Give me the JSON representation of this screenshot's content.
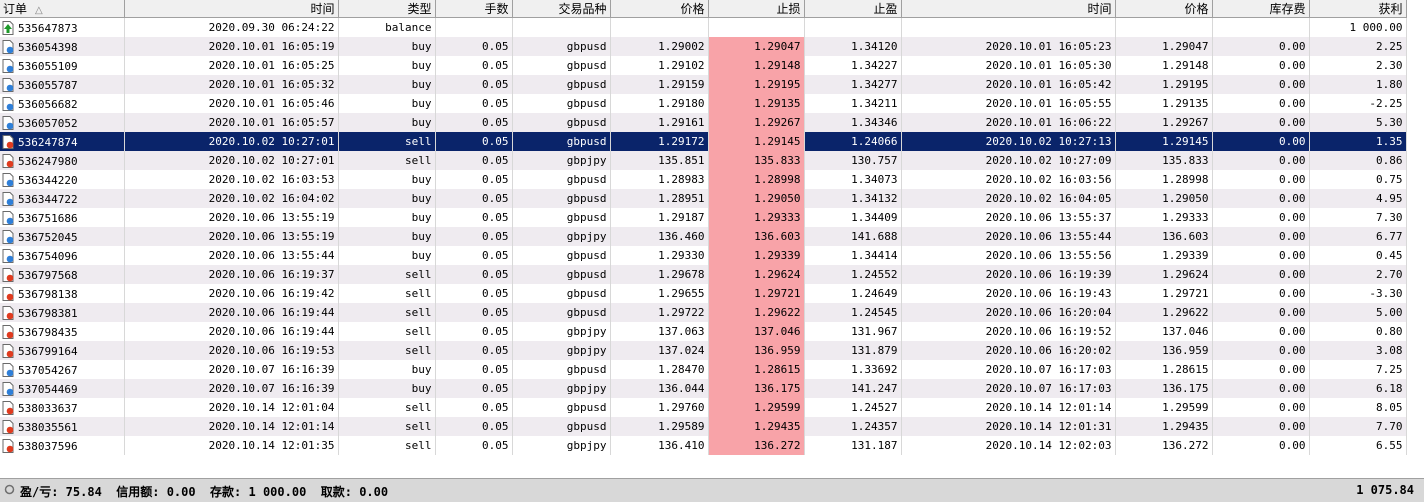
{
  "columns": [
    "订单",
    "时间",
    "类型",
    "手数",
    "交易品种",
    "价格",
    "止损",
    "止盈",
    "时间",
    "价格",
    "库存费",
    "获利"
  ],
  "sort_indicator": "△",
  "rows": [
    {
      "ticket": "535647873",
      "open_time": "2020.09.30 06:24:22",
      "type": "balance",
      "lots": "",
      "symbol": "",
      "price": "",
      "sl": "",
      "tp": "",
      "close_time": "",
      "close_price": "",
      "swap": "",
      "profit": "1 000.00",
      "icon": "deposit-icon"
    },
    {
      "ticket": "536054398",
      "open_time": "2020.10.01 16:05:19",
      "type": "buy",
      "lots": "0.05",
      "symbol": "gbpusd",
      "price": "1.29002",
      "sl": "1.29047",
      "tp": "1.34120",
      "close_time": "2020.10.01 16:05:23",
      "close_price": "1.29047",
      "swap": "0.00",
      "profit": "2.25",
      "icon": "buy-order-icon"
    },
    {
      "ticket": "536055109",
      "open_time": "2020.10.01 16:05:25",
      "type": "buy",
      "lots": "0.05",
      "symbol": "gbpusd",
      "price": "1.29102",
      "sl": "1.29148",
      "tp": "1.34227",
      "close_time": "2020.10.01 16:05:30",
      "close_price": "1.29148",
      "swap": "0.00",
      "profit": "2.30",
      "icon": "buy-order-icon"
    },
    {
      "ticket": "536055787",
      "open_time": "2020.10.01 16:05:32",
      "type": "buy",
      "lots": "0.05",
      "symbol": "gbpusd",
      "price": "1.29159",
      "sl": "1.29195",
      "tp": "1.34277",
      "close_time": "2020.10.01 16:05:42",
      "close_price": "1.29195",
      "swap": "0.00",
      "profit": "1.80",
      "icon": "buy-order-icon"
    },
    {
      "ticket": "536056682",
      "open_time": "2020.10.01 16:05:46",
      "type": "buy",
      "lots": "0.05",
      "symbol": "gbpusd",
      "price": "1.29180",
      "sl": "1.29135",
      "tp": "1.34211",
      "close_time": "2020.10.01 16:05:55",
      "close_price": "1.29135",
      "swap": "0.00",
      "profit": "-2.25",
      "icon": "buy-order-icon"
    },
    {
      "ticket": "536057052",
      "open_time": "2020.10.01 16:05:57",
      "type": "buy",
      "lots": "0.05",
      "symbol": "gbpusd",
      "price": "1.29161",
      "sl": "1.29267",
      "tp": "1.34346",
      "close_time": "2020.10.01 16:06:22",
      "close_price": "1.29267",
      "swap": "0.00",
      "profit": "5.30",
      "icon": "buy-order-icon"
    },
    {
      "ticket": "536247874",
      "open_time": "2020.10.02 10:27:01",
      "type": "sell",
      "lots": "0.05",
      "symbol": "gbpusd",
      "price": "1.29172",
      "sl": "1.29145",
      "tp": "1.24066",
      "close_time": "2020.10.02 10:27:13",
      "close_price": "1.29145",
      "swap": "0.00",
      "profit": "1.35",
      "icon": "sell-order-icon",
      "selected": true
    },
    {
      "ticket": "536247980",
      "open_time": "2020.10.02 10:27:01",
      "type": "sell",
      "lots": "0.05",
      "symbol": "gbpjpy",
      "price": "135.851",
      "sl": "135.833",
      "tp": "130.757",
      "close_time": "2020.10.02 10:27:09",
      "close_price": "135.833",
      "swap": "0.00",
      "profit": "0.86",
      "icon": "sell-order-icon"
    },
    {
      "ticket": "536344220",
      "open_time": "2020.10.02 16:03:53",
      "type": "buy",
      "lots": "0.05",
      "symbol": "gbpusd",
      "price": "1.28983",
      "sl": "1.28998",
      "tp": "1.34073",
      "close_time": "2020.10.02 16:03:56",
      "close_price": "1.28998",
      "swap": "0.00",
      "profit": "0.75",
      "icon": "buy-order-icon"
    },
    {
      "ticket": "536344722",
      "open_time": "2020.10.02 16:04:02",
      "type": "buy",
      "lots": "0.05",
      "symbol": "gbpusd",
      "price": "1.28951",
      "sl": "1.29050",
      "tp": "1.34132",
      "close_time": "2020.10.02 16:04:05",
      "close_price": "1.29050",
      "swap": "0.00",
      "profit": "4.95",
      "icon": "buy-order-icon"
    },
    {
      "ticket": "536751686",
      "open_time": "2020.10.06 13:55:19",
      "type": "buy",
      "lots": "0.05",
      "symbol": "gbpusd",
      "price": "1.29187",
      "sl": "1.29333",
      "tp": "1.34409",
      "close_time": "2020.10.06 13:55:37",
      "close_price": "1.29333",
      "swap": "0.00",
      "profit": "7.30",
      "icon": "buy-order-icon"
    },
    {
      "ticket": "536752045",
      "open_time": "2020.10.06 13:55:19",
      "type": "buy",
      "lots": "0.05",
      "symbol": "gbpjpy",
      "price": "136.460",
      "sl": "136.603",
      "tp": "141.688",
      "close_time": "2020.10.06 13:55:44",
      "close_price": "136.603",
      "swap": "0.00",
      "profit": "6.77",
      "icon": "buy-order-icon"
    },
    {
      "ticket": "536754096",
      "open_time": "2020.10.06 13:55:44",
      "type": "buy",
      "lots": "0.05",
      "symbol": "gbpusd",
      "price": "1.29330",
      "sl": "1.29339",
      "tp": "1.34414",
      "close_time": "2020.10.06 13:55:56",
      "close_price": "1.29339",
      "swap": "0.00",
      "profit": "0.45",
      "icon": "buy-order-icon"
    },
    {
      "ticket": "536797568",
      "open_time": "2020.10.06 16:19:37",
      "type": "sell",
      "lots": "0.05",
      "symbol": "gbpusd",
      "price": "1.29678",
      "sl": "1.29624",
      "tp": "1.24552",
      "close_time": "2020.10.06 16:19:39",
      "close_price": "1.29624",
      "swap": "0.00",
      "profit": "2.70",
      "icon": "sell-order-icon"
    },
    {
      "ticket": "536798138",
      "open_time": "2020.10.06 16:19:42",
      "type": "sell",
      "lots": "0.05",
      "symbol": "gbpusd",
      "price": "1.29655",
      "sl": "1.29721",
      "tp": "1.24649",
      "close_time": "2020.10.06 16:19:43",
      "close_price": "1.29721",
      "swap": "0.00",
      "profit": "-3.30",
      "icon": "sell-order-icon"
    },
    {
      "ticket": "536798381",
      "open_time": "2020.10.06 16:19:44",
      "type": "sell",
      "lots": "0.05",
      "symbol": "gbpusd",
      "price": "1.29722",
      "sl": "1.29622",
      "tp": "1.24545",
      "close_time": "2020.10.06 16:20:04",
      "close_price": "1.29622",
      "swap": "0.00",
      "profit": "5.00",
      "icon": "sell-order-icon"
    },
    {
      "ticket": "536798435",
      "open_time": "2020.10.06 16:19:44",
      "type": "sell",
      "lots": "0.05",
      "symbol": "gbpjpy",
      "price": "137.063",
      "sl": "137.046",
      "tp": "131.967",
      "close_time": "2020.10.06 16:19:52",
      "close_price": "137.046",
      "swap": "0.00",
      "profit": "0.80",
      "icon": "sell-order-icon"
    },
    {
      "ticket": "536799164",
      "open_time": "2020.10.06 16:19:53",
      "type": "sell",
      "lots": "0.05",
      "symbol": "gbpjpy",
      "price": "137.024",
      "sl": "136.959",
      "tp": "131.879",
      "close_time": "2020.10.06 16:20:02",
      "close_price": "136.959",
      "swap": "0.00",
      "profit": "3.08",
      "icon": "sell-order-icon"
    },
    {
      "ticket": "537054267",
      "open_time": "2020.10.07 16:16:39",
      "type": "buy",
      "lots": "0.05",
      "symbol": "gbpusd",
      "price": "1.28470",
      "sl": "1.28615",
      "tp": "1.33692",
      "close_time": "2020.10.07 16:17:03",
      "close_price": "1.28615",
      "swap": "0.00",
      "profit": "7.25",
      "icon": "buy-order-icon"
    },
    {
      "ticket": "537054469",
      "open_time": "2020.10.07 16:16:39",
      "type": "buy",
      "lots": "0.05",
      "symbol": "gbpjpy",
      "price": "136.044",
      "sl": "136.175",
      "tp": "141.247",
      "close_time": "2020.10.07 16:17:03",
      "close_price": "136.175",
      "swap": "0.00",
      "profit": "6.18",
      "icon": "buy-order-icon"
    },
    {
      "ticket": "538033637",
      "open_time": "2020.10.14 12:01:04",
      "type": "sell",
      "lots": "0.05",
      "symbol": "gbpusd",
      "price": "1.29760",
      "sl": "1.29599",
      "tp": "1.24527",
      "close_time": "2020.10.14 12:01:14",
      "close_price": "1.29599",
      "swap": "0.00",
      "profit": "8.05",
      "icon": "sell-order-icon"
    },
    {
      "ticket": "538035561",
      "open_time": "2020.10.14 12:01:14",
      "type": "sell",
      "lots": "0.05",
      "symbol": "gbpusd",
      "price": "1.29589",
      "sl": "1.29435",
      "tp": "1.24357",
      "close_time": "2020.10.14 12:01:31",
      "close_price": "1.29435",
      "swap": "0.00",
      "profit": "7.70",
      "icon": "sell-order-icon"
    },
    {
      "ticket": "538037596",
      "open_time": "2020.10.14 12:01:35",
      "type": "sell",
      "lots": "0.05",
      "symbol": "gbpjpy",
      "price": "136.410",
      "sl": "136.272",
      "tp": "131.187",
      "close_time": "2020.10.14 12:02:03",
      "close_price": "136.272",
      "swap": "0.00",
      "profit": "6.55",
      "icon": "sell-order-icon"
    }
  ],
  "status": {
    "summary": "盈/亏: 75.84  信用额: 0.00  存款: 1 000.00  取款: 0.00",
    "total": "1 075.84"
  },
  "colors": {
    "selected_row": "#0a246a",
    "stop_loss_hit": "#f8a3a8",
    "alt_row": "#efebf0"
  }
}
